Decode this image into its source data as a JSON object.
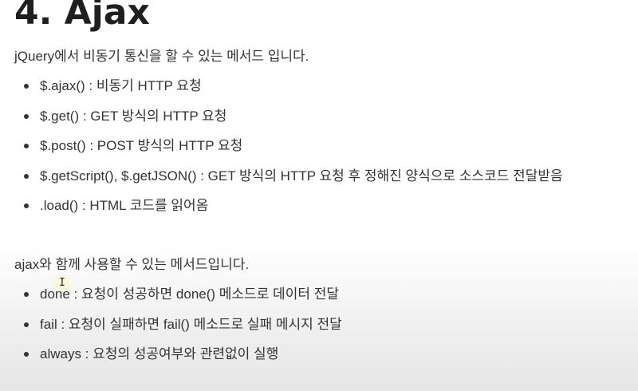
{
  "heading": "4. Ajax",
  "section1": {
    "intro": "jQuery에서 비동기 통신을 할 수 있는 메서드 입니다.",
    "items": [
      "$.ajax() : 비동기 HTTP 요청",
      "$.get() : GET 방식의 HTTP 요청",
      "$.post() : POST 방식의 HTTP 요청",
      "$.getScript(), $.getJSON() : GET 방식의 HTTP 요청 후 정해진 양식으로 소스코드 전달받음",
      ".load() : HTML 코드를 읽어옴"
    ]
  },
  "section2": {
    "intro": "ajax와 함께 사용할 수 있는 메서드입니다.",
    "items": [
      "done : 요청이 성공하면 done() 메소드로 데이터 전달",
      "fail : 요청이 실패하면 fail() 메소드로 실패 메시지 전달",
      "always : 요청의 성공여부와 관련없이 실행"
    ]
  },
  "colors": {
    "text": "#333333",
    "heading": "#1f1f1f"
  }
}
